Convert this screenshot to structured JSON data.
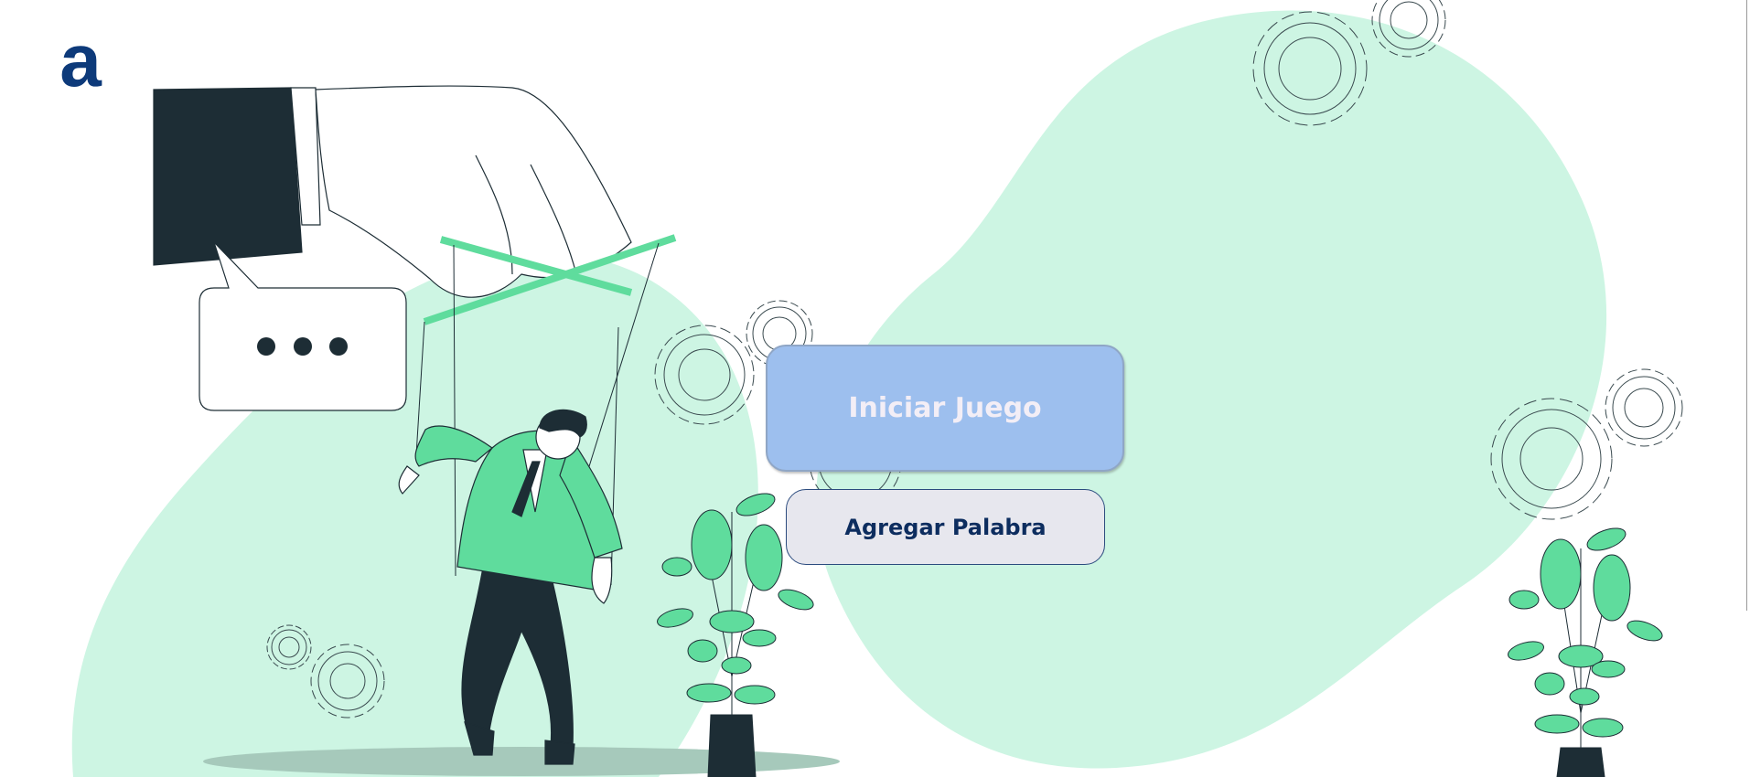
{
  "app": {
    "logo_icon": "letter-a-logo",
    "logo_letter": "a",
    "logo_color": "#0d3a7a"
  },
  "buttons": {
    "start_label": "Iniciar Juego",
    "add_word_label": "Agregar Palabra"
  },
  "colors": {
    "blob": "#cdf5e3",
    "accent_green": "#5fdc9d",
    "dark": "#1d2d35",
    "start_button": "#9dbfee",
    "add_word_button": "#e7e7ee",
    "add_word_text": "#0d2d5f"
  },
  "illustration": {
    "subject": "puppeteer-hand-controlling-businessman-marionette",
    "speech_bubble_icon": "ellipsis-speech-bubble-icon",
    "decor_icons": [
      "gear-icon",
      "potted-plant-icon"
    ]
  }
}
